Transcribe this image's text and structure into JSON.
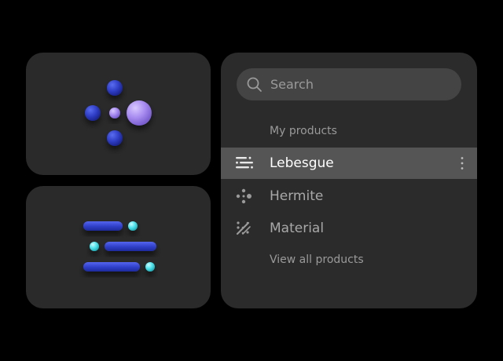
{
  "search": {
    "placeholder": "Search"
  },
  "section": {
    "label": "My products"
  },
  "products": [
    {
      "label": "Lebesgue",
      "icon": "lebesgue-lines-icon",
      "selected": true
    },
    {
      "label": "Hermite",
      "icon": "hermite-dots-icon",
      "selected": false
    },
    {
      "label": "Material",
      "icon": "material-pattern-icon",
      "selected": false
    }
  ],
  "view_all": {
    "label": "View all products"
  },
  "colors": {
    "background": "#000000",
    "card": "#2a2a2a",
    "panel": "#2b2b2b",
    "selected_row": "#555555",
    "blue": "#2f3fc8",
    "violet": "#a88cf0",
    "cyan": "#4fe3ec"
  }
}
